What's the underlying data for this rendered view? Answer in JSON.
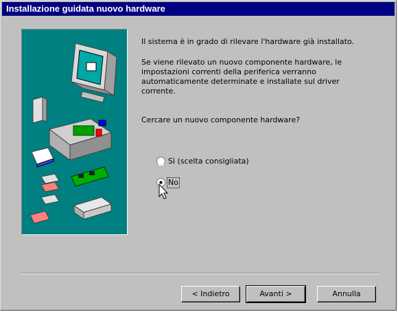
{
  "window": {
    "title": "Installazione guidata nuovo hardware"
  },
  "body": {
    "intro": "Il sistema è in grado di rilevare l'hardware già installato.",
    "detail_lines": [
      "Se viene rilevato un nuovo componente hardware, le",
      "impostazioni correnti della periferica verranno",
      "automaticamente determinate e installate sul driver",
      "corrente."
    ],
    "question": "Cercare un nuovo componente hardware?"
  },
  "options": [
    {
      "label": "Sì (scelta consigliata)",
      "selected": false
    },
    {
      "label": "No",
      "selected": true
    }
  ],
  "buttons": {
    "back": "< Indietro",
    "next": "Avanti >",
    "cancel": "Annulla"
  },
  "colors": {
    "title_bar": "#000080",
    "face": "#c0c0c0",
    "art_background": "#008080"
  }
}
